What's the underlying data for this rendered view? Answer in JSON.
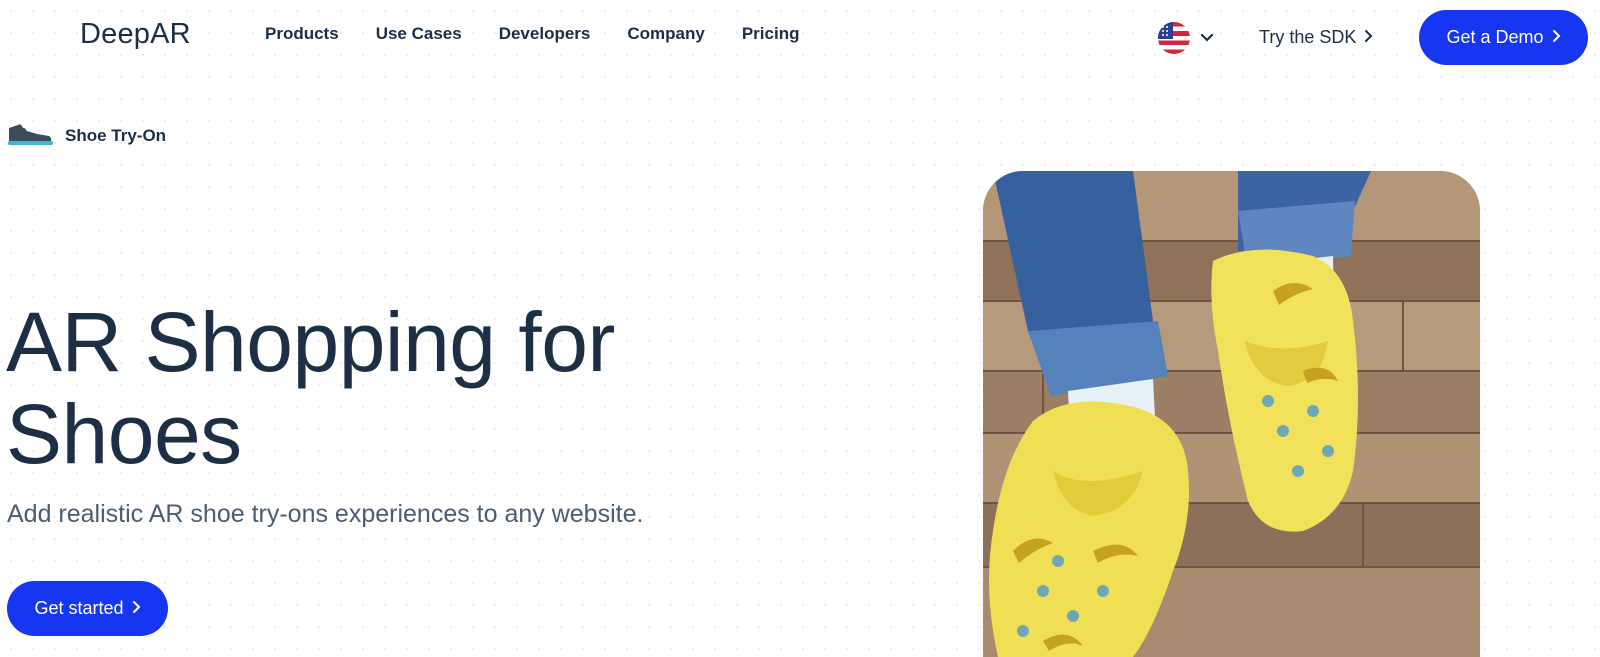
{
  "header": {
    "logo": "DeepAR",
    "nav": [
      "Products",
      "Use Cases",
      "Developers",
      "Company",
      "Pricing"
    ],
    "language_icon": "us-flag-icon",
    "try_sdk": "Try the SDK",
    "demo_button": "Get a Demo"
  },
  "badge": {
    "icon": "sneaker-icon",
    "label": "Shoe Try-On"
  },
  "hero": {
    "title_line1": "AR Shopping for",
    "title_line2": "Shoes",
    "subtitle": "Add realistic AR shoe try-ons experiences to any website.",
    "cta": "Get started",
    "image": "photo of feet wearing yellow banana-print clogs on wooden floor"
  },
  "colors": {
    "primary": "#1636f2",
    "text": "#1c2f45",
    "subtext": "#4c5d70"
  }
}
